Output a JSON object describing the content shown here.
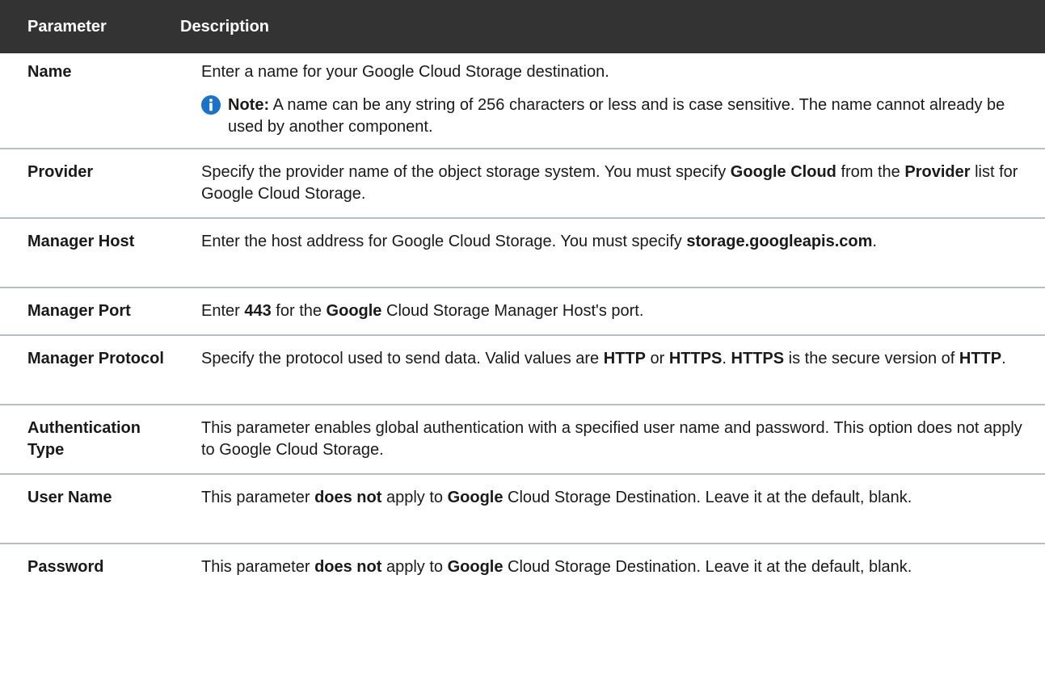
{
  "header": {
    "parameter": "Parameter",
    "description": "Description"
  },
  "colors": {
    "header_bg": "#333333",
    "row_border": "#b7bec6",
    "info_icon": "#1a73c8"
  },
  "icons": {
    "note": "info-icon"
  },
  "rows": [
    {
      "name": "Name",
      "desc": [
        "Enter a name for your Google Cloud Storage destination."
      ],
      "note_label": "Note:",
      "note_text": " A name can be any string of 256 characters or less and is case sensitive. The name cannot already be used by another component."
    },
    {
      "name": "Provider",
      "desc": [
        "Specify the provider name of the object storage system. You must specify ",
        "Google Cloud",
        " from the ",
        "Provider",
        " list for Google Cloud Storage."
      ]
    },
    {
      "name": "Manager Host",
      "desc": [
        "Enter the host address for Google Cloud Storage. You must specify ",
        "storage.googleapis.com",
        "."
      ]
    },
    {
      "name": "Manager Port",
      "desc": [
        "Enter ",
        "443",
        " for the ",
        "Google",
        " Cloud Storage Manager Host's port."
      ]
    },
    {
      "name": "Manager Protocol",
      "desc": [
        "Specify the protocol used to send data. Valid values are ",
        "HTTP",
        " or ",
        "HTTPS",
        ". ",
        "HTTPS",
        " is the secure version of ",
        "HTTP",
        "."
      ]
    },
    {
      "name": "Authentication Type",
      "desc": [
        "This parameter enables global authentication with a specified user name and password. This option does not apply to Google Cloud Storage."
      ]
    },
    {
      "name": "User Name",
      "desc": [
        "This parameter ",
        "does not",
        " apply to ",
        "Google",
        " Cloud Storage Destination. Leave it at the default, blank."
      ]
    },
    {
      "name": "Password",
      "desc": [
        "This parameter ",
        "does not",
        " apply to ",
        "Google",
        " Cloud Storage Destination. Leave it at the default, blank."
      ]
    }
  ]
}
